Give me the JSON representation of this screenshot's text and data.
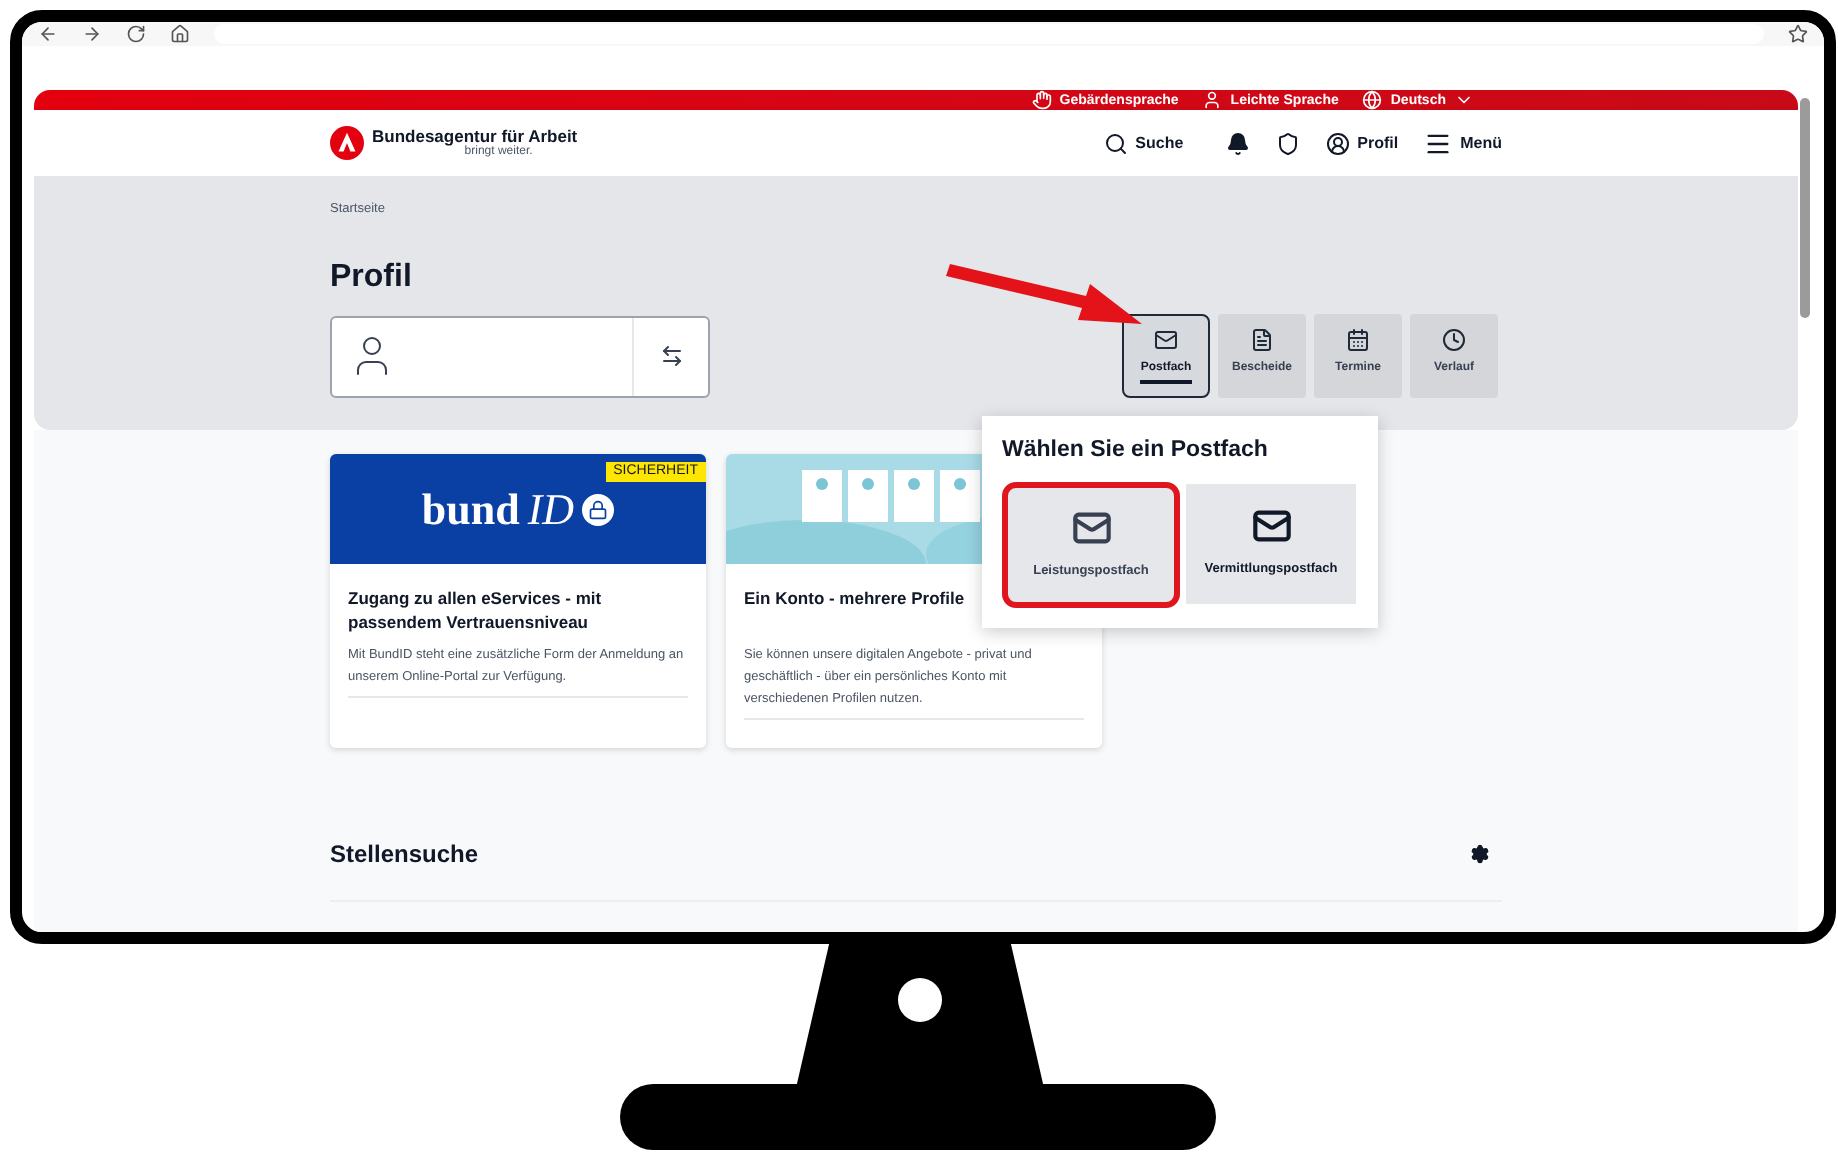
{
  "top_bar": {
    "links": [
      {
        "kind": "sign",
        "label": "Gebärdensprache"
      },
      {
        "kind": "easy",
        "label": "Leichte Sprache"
      },
      {
        "kind": "language",
        "label": "Deutsch"
      }
    ]
  },
  "header": {
    "brand": "Bundesagentur für Arbeit",
    "slogan": "bringt weiter.",
    "search": "Suche",
    "profile": "Profil",
    "menu": "Menü"
  },
  "breadcrumb": "Startseite",
  "title": "Profil",
  "tabs": [
    {
      "kind": "mail",
      "label": "Postfach",
      "selected": true
    },
    {
      "kind": "doc",
      "label": "Bescheide",
      "selected": false
    },
    {
      "kind": "calendar",
      "label": "Termine",
      "selected": false
    },
    {
      "kind": "clock",
      "label": "Verlauf",
      "selected": false
    }
  ],
  "popup": {
    "title": "Wählen Sie ein Postfach",
    "options": [
      {
        "label": "Leistungspostfach",
        "selected": true
      },
      {
        "label": "Vermittlungspostfach",
        "selected": false
      }
    ]
  },
  "cards": [
    {
      "kind": "bundid",
      "logo_word": "bund",
      "logo_id": "ID",
      "badge": "SICHERHEIT",
      "title": "Zugang zu allen eServices - mit passendem Vertrauensniveau",
      "text": "Mit BundID steht eine zusätzliche Form der Anmeldung an unserem Online-Portal zur Verfügung."
    },
    {
      "kind": "picture",
      "title": "Ein Konto - mehrere Profile",
      "text": "Sie können unsere digitalen Angebote - privat und geschäftlich - über ein persönliches Konto mit verschiedenen Profilen nutzen."
    }
  ],
  "section": {
    "title": "Stellensuche"
  }
}
